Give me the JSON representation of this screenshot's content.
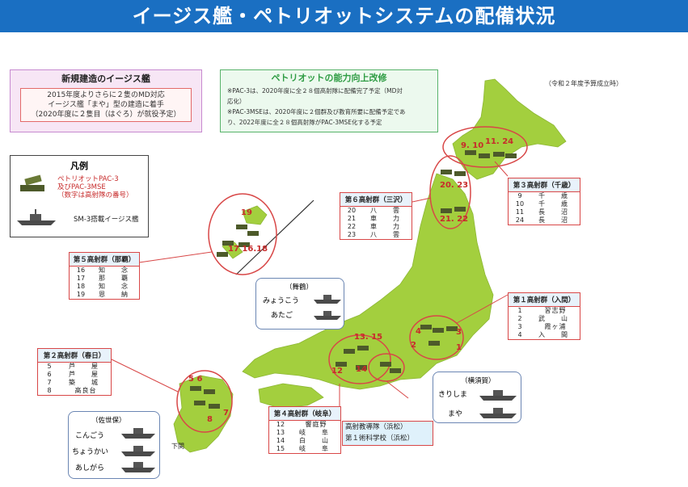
{
  "header": {
    "title": "イージス艦・ペトリオットシステムの配備状況"
  },
  "budget_note": "（令和２年度予算成立時）",
  "new_aegis": {
    "title": "新規建造のイージス艦",
    "lines": [
      "2015年度よりさらに２隻のMD対応",
      "イージス艦「まや」型の建造に着手",
      "（2020年度に２隻目（はぐろ）が就役予定）"
    ]
  },
  "patriot_upgrade": {
    "title": "ペトリオットの能力向上改修",
    "lines": [
      "※PAC-3は、2020年度に全２８個高射隊に配備完了予定（MD対",
      "応化）",
      "※PAC-3MSEは、2020年度に２個群及び教育所要に配備予定であ",
      "り、2022年度に全２８個高射隊がPAC-3MSE化する予定"
    ]
  },
  "legend": {
    "title": "凡例",
    "patriot_label": [
      "ペトリオットPAC-3",
      "及びPAC-3MSE",
      "（数字は高射隊の番号）"
    ],
    "aegis_label": "SM-3搭載イージス艦"
  },
  "groups": {
    "g5": {
      "title": "第５高射群（那覇）",
      "rows": [
        [
          "16",
          "知　念"
        ],
        [
          "17",
          "那　覇"
        ],
        [
          "18",
          "知　念"
        ],
        [
          "19",
          "恩　納"
        ]
      ]
    },
    "g6": {
      "title": "第６高射群（三沢）",
      "rows": [
        [
          "20",
          "八　雲"
        ],
        [
          "21",
          "車　力"
        ],
        [
          "22",
          "車　力"
        ],
        [
          "23",
          "八　雲"
        ]
      ]
    },
    "g3": {
      "title": "第３高射群（千歳）",
      "rows": [
        [
          "9",
          "千　歳"
        ],
        [
          "10",
          "千　歳"
        ],
        [
          "11",
          "長　沼"
        ],
        [
          "24",
          "長　沼"
        ]
      ]
    },
    "g1": {
      "title": "第１高射群（入間）",
      "rows": [
        [
          "1",
          "習志野"
        ],
        [
          "2",
          "武　山"
        ],
        [
          "3",
          "霞ヶ浦"
        ],
        [
          "4",
          "入　間"
        ]
      ]
    },
    "g2": {
      "title": "第２高射群（春日）",
      "rows": [
        [
          "5",
          "芦　屋"
        ],
        [
          "6",
          "芦　屋"
        ],
        [
          "7",
          "築　城"
        ],
        [
          "8",
          "高良台"
        ]
      ]
    },
    "g4": {
      "title": "第４高射群（岐阜）",
      "rows": [
        [
          "12",
          "饗庭野"
        ],
        [
          "13",
          "岐　阜"
        ],
        [
          "14",
          "白　山"
        ],
        [
          "15",
          "岐　阜"
        ]
      ]
    }
  },
  "hq": {
    "line1": "高射教導隊（浜松）",
    "line2": "第１術科学校（浜松）"
  },
  "bases": {
    "maizuru": {
      "title": "（舞鶴）",
      "ships": [
        "みょうこう",
        "あたご"
      ]
    },
    "yokosuka": {
      "title": "（横須賀）",
      "ships": [
        "きりしま",
        "まや"
      ]
    },
    "sasebo": {
      "title": "（佐世保）",
      "ships": [
        "こんごう",
        "ちょうかい",
        "あしがら"
      ]
    }
  },
  "shimonoseki": "下関",
  "marks": {
    "m19": "19",
    "m171618": "17 16.18",
    "m910": "9. 10",
    "m1124": "11. 24",
    "m2023": "20. 23",
    "m2122": "21. 22",
    "m1315": "13. 15",
    "m12": "12",
    "m14": "14",
    "m4": "4",
    "m2": "2",
    "m3": "3",
    "m1": "1",
    "m56": "5 6",
    "m7": "7",
    "m8": "8"
  },
  "colors": {
    "header": "#1a6fc2",
    "land": "#a3cf3e",
    "circle": "#d84747"
  }
}
